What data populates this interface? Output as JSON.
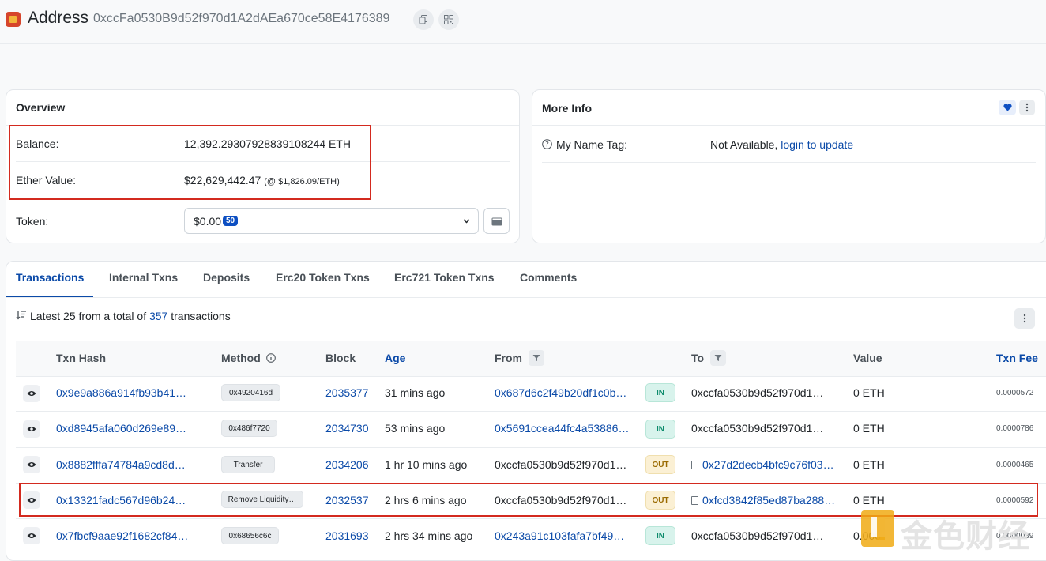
{
  "header": {
    "title": "Address",
    "address": "0xccFa0530B9d52f970d1A2dAEa670ce58E4176389"
  },
  "overview": {
    "title": "Overview",
    "balance_label": "Balance:",
    "balance_value": "12,392.29307928839108244 ETH",
    "ether_value_label": "Ether Value:",
    "ether_value": "$22,629,442.47",
    "ether_rate": "(@ $1,826.09/ETH)",
    "token_label": "Token:",
    "token_value": "$0.00",
    "token_count": "50"
  },
  "more_info": {
    "title": "More Info",
    "name_tag_label": "My Name Tag:",
    "name_tag_value": "Not Available,",
    "name_tag_link": "login to update"
  },
  "tabs": [
    {
      "label": "Transactions",
      "active": true
    },
    {
      "label": "Internal Txns"
    },
    {
      "label": "Deposits"
    },
    {
      "label": "Erc20 Token Txns"
    },
    {
      "label": "Erc721 Token Txns"
    },
    {
      "label": "Comments"
    }
  ],
  "summary": {
    "prefix": "Latest 25 from a total of",
    "count": "357",
    "suffix": "transactions"
  },
  "table": {
    "headers": {
      "hash": "Txn Hash",
      "method": "Method",
      "block": "Block",
      "age": "Age",
      "from": "From",
      "to": "To",
      "value": "Value",
      "fee": "Txn Fee"
    },
    "rows": [
      {
        "hash": "0x9e9a886a914fb93b41…",
        "method": "0x4920416d",
        "block": "2035377",
        "age": "31 mins ago",
        "from": "0x687d6c2f49b20df1c0b…",
        "dir": "IN",
        "to": "0xccfa0530b9d52f970d1…",
        "value": "0 ETH",
        "fee": "0.0000572"
      },
      {
        "hash": "0xd8945afa060d269e89…",
        "method": "0x486f7720",
        "block": "2034730",
        "age": "53 mins ago",
        "from": "0x5691ccea44fc4a53886…",
        "dir": "IN",
        "to": "0xccfa0530b9d52f970d1…",
        "value": "0 ETH",
        "fee": "0.0000786"
      },
      {
        "hash": "0x8882fffa74784a9cd8d…",
        "method": "Transfer",
        "block": "2034206",
        "age": "1 hr 10 mins ago",
        "from": "0xccfa0530b9d52f970d1…",
        "dir": "OUT",
        "to": "0x27d2decb4bfc9c76f03…",
        "value": "0 ETH",
        "fee": "0.0000465"
      },
      {
        "hash": "0x13321fadc567d96b24…",
        "method": "Remove Liquidity…",
        "block": "2032537",
        "age": "2 hrs 6 mins ago",
        "from": "0xccfa0530b9d52f970d1…",
        "dir": "OUT",
        "to": "0xfcd3842f85ed87ba288…",
        "value": "0 ETH",
        "fee": "0.0000592"
      },
      {
        "hash": "0x7fbcf9aae92f1682cf84…",
        "method": "0x68656c6c",
        "block": "2031693",
        "age": "2 hrs 34 mins ago",
        "from": "0x243a91c103fafa7bf49…",
        "dir": "IN",
        "to": "0xccfa0530b9d52f970d1…",
        "value": "0.000",
        "fee": "0.0000039"
      }
    ]
  },
  "watermark": "金色财经",
  "colors": {
    "link": "#0b4aa8",
    "highlight": "#d32a1f",
    "in_badge": "#d8f3ec",
    "out_badge": "#fbf0d4"
  }
}
